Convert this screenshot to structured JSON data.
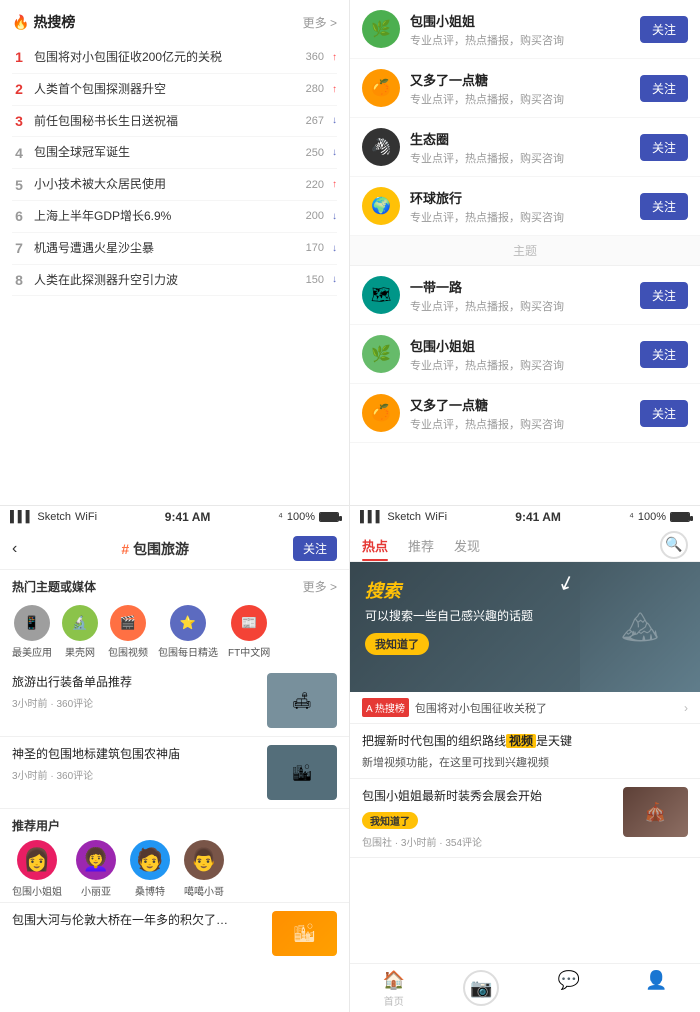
{
  "panel1": {
    "title": "热搜榜",
    "more": "更多 >",
    "items": [
      {
        "rank": "1",
        "rankClass": "top1",
        "text": "包围将对小包围征收200亿元的关税",
        "num": "360",
        "trend": "up"
      },
      {
        "rank": "2",
        "rankClass": "top2",
        "text": "人类首个包围探测器升空",
        "num": "280",
        "trend": "up"
      },
      {
        "rank": "3",
        "rankClass": "top3",
        "text": "前任包围秘书长生日送祝福",
        "num": "267",
        "trend": "down"
      },
      {
        "rank": "4",
        "rankClass": "normal",
        "text": "包围全球冠军诞生",
        "num": "250",
        "trend": "down"
      },
      {
        "rank": "5",
        "rankClass": "normal",
        "text": "小小技术被大众居民使用",
        "num": "220",
        "trend": "up"
      },
      {
        "rank": "6",
        "rankClass": "normal",
        "text": "上海上半年GDP增长6.9%",
        "num": "200",
        "trend": "down"
      },
      {
        "rank": "7",
        "rankClass": "normal",
        "text": "机遇号遭遇火星沙尘暴",
        "num": "170",
        "trend": "down"
      },
      {
        "rank": "8",
        "rankClass": "normal",
        "text": "人类在此探测器升空引力波",
        "num": "150",
        "trend": "down"
      }
    ]
  },
  "panel2": {
    "followItems": [
      {
        "name": "包围小姐姐",
        "desc": "专业点评，热点播报，购买咨询",
        "avatarEmoji": "🌿",
        "avatarClass": "avatar-green"
      },
      {
        "name": "又多了一点糖",
        "desc": "专业点评，热点播报，购买咨询",
        "avatarEmoji": "🍊",
        "avatarClass": "avatar-orange"
      },
      {
        "name": "生态圈",
        "desc": "专业点评，热点播报，购买咨询",
        "avatarEmoji": "🦓",
        "avatarClass": "avatar-zebra"
      },
      {
        "name": "环球旅行",
        "desc": "专业点评，热点播报，购买咨询",
        "avatarEmoji": "🌍",
        "avatarClass": "avatar-amber"
      }
    ],
    "dividerText": "主题",
    "themeItems": [
      {
        "name": "一带一路",
        "desc": "专业点评，热点播报，购买咨询",
        "avatarEmoji": "🗺",
        "avatarClass": "avatar-teal"
      },
      {
        "name": "包围小姐姐",
        "desc": "专业点评，热点播报，购买咨询",
        "avatarEmoji": "🌿",
        "avatarClass": "avatar-green2"
      },
      {
        "name": "又多了一点糖",
        "desc": "专业点评，热点播报，购买咨询",
        "avatarEmoji": "🍊",
        "avatarClass": "avatar-orange"
      }
    ],
    "followLabel": "关注"
  },
  "panel3": {
    "statusBar": {
      "signal": "Sketch",
      "wifi": "WiFi",
      "time": "9:41 AM",
      "bluetooth": "⁴",
      "battery": "100%"
    },
    "hashtag": "#",
    "title": "包围旅游",
    "followLabel": "关注",
    "hotTopicsLabel": "热门主题或媒体",
    "moreLabel": "更多 >",
    "topics": [
      {
        "label": "最美应用",
        "emoji": "📱",
        "color": "#9e9e9e"
      },
      {
        "label": "果壳网",
        "emoji": "🔬",
        "color": "#8bc34a"
      },
      {
        "label": "包围视频",
        "emoji": "🎬",
        "color": "#ff7043"
      },
      {
        "label": "包围每日精选",
        "emoji": "⭐",
        "color": "#5c6bc0"
      },
      {
        "label": "FT中文网",
        "emoji": "📰",
        "color": "#f44336"
      }
    ],
    "articles": [
      {
        "title": "旅游出行装备单品推荐",
        "meta": "3小时前 · 360评论",
        "thumbColor": "#78909c",
        "thumbEmoji": "🛋"
      },
      {
        "title": "神圣的包围地标建筑包围农神庙",
        "meta": "3小时前 · 360评论",
        "thumbColor": "#546e7a",
        "thumbEmoji": "🏙"
      }
    ],
    "recommendLabel": "推荐用户",
    "recommendUsers": [
      {
        "name": "包围小姐姐",
        "color": "#e91e63",
        "emoji": "👩"
      },
      {
        "name": "小丽亚",
        "color": "#9c27b0",
        "emoji": "👩‍🦱"
      },
      {
        "name": "桑博特",
        "color": "#2196f3",
        "emoji": "🧑"
      },
      {
        "name": "噶噶小哥",
        "color": "#795548",
        "emoji": "👨"
      }
    ],
    "lastArticleTitle": "包围大河与伦敦大桥在一年多的积欠了…"
  },
  "panel4": {
    "statusBar": {
      "signal": "Sketch",
      "wifi": "WiFi",
      "time": "9:41 AM",
      "bluetooth": "⁴",
      "battery": "100%"
    },
    "tabs": [
      "热点",
      "推荐",
      "发现"
    ],
    "activeTab": 0,
    "bannerTitle": "搜索",
    "bannerSubtitle": "可以搜索一些自己感兴趣的话题",
    "bannerBadge": "我知道了",
    "hotStrip": {
      "badge": "A 热搜榜",
      "text": "包围将对小包围征收关税了"
    },
    "card1Title": "把握新时代包围的组织路线",
    "card1Highlight": "视频",
    "card1Suffix": "是天键",
    "card1Desc": "新增视频功能，在这里可找到兴趣视频",
    "card2Title": "包围小姐姐最新时装秀会展会开始",
    "card2Badge": "我知道了",
    "card2Meta": "包围社 · 3小时前 · 354评论",
    "bottomBar": [
      {
        "label": "首页",
        "icon": "🏠"
      },
      {
        "label": "",
        "icon": "📷"
      },
      {
        "label": "",
        "icon": "💬"
      },
      {
        "label": "",
        "icon": "👤"
      }
    ]
  }
}
